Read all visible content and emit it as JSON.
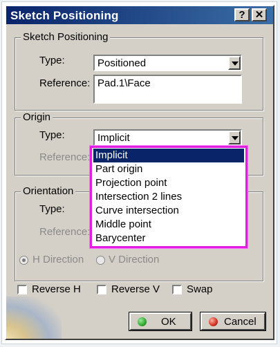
{
  "window": {
    "title": "Sketch Positioning",
    "help_label": "?",
    "close_label": "✕"
  },
  "sketch_positioning": {
    "title": "Sketch Positioning",
    "type_label": "Type:",
    "type_value": "Positioned",
    "reference_label": "Reference:",
    "reference_value": "Pad.1\\Face"
  },
  "origin": {
    "title": "Origin",
    "type_label": "Type:",
    "type_value": "Implicit",
    "reference_label": "Reference:",
    "dropdown_options": [
      "Implicit",
      "Part origin",
      "Projection point",
      "Intersection 2 lines",
      "Curve intersection",
      "Middle point",
      "Barycenter"
    ],
    "selected_index": 0
  },
  "orientation": {
    "title": "Orientation",
    "type_label": "Type:",
    "reference_label": "Reference:",
    "h_direction_label": "H Direction",
    "v_direction_label": "V Direction",
    "selected_direction": "H Direction"
  },
  "options": {
    "reverse_h_label": "Reverse H",
    "reverse_v_label": "Reverse V",
    "swap_label": "Swap"
  },
  "buttons": {
    "ok_label": "OK",
    "cancel_label": "Cancel"
  },
  "colors": {
    "ok_icon": "#2fa82f",
    "cancel_icon": "#d03020",
    "highlight_border": "#e020e0"
  }
}
